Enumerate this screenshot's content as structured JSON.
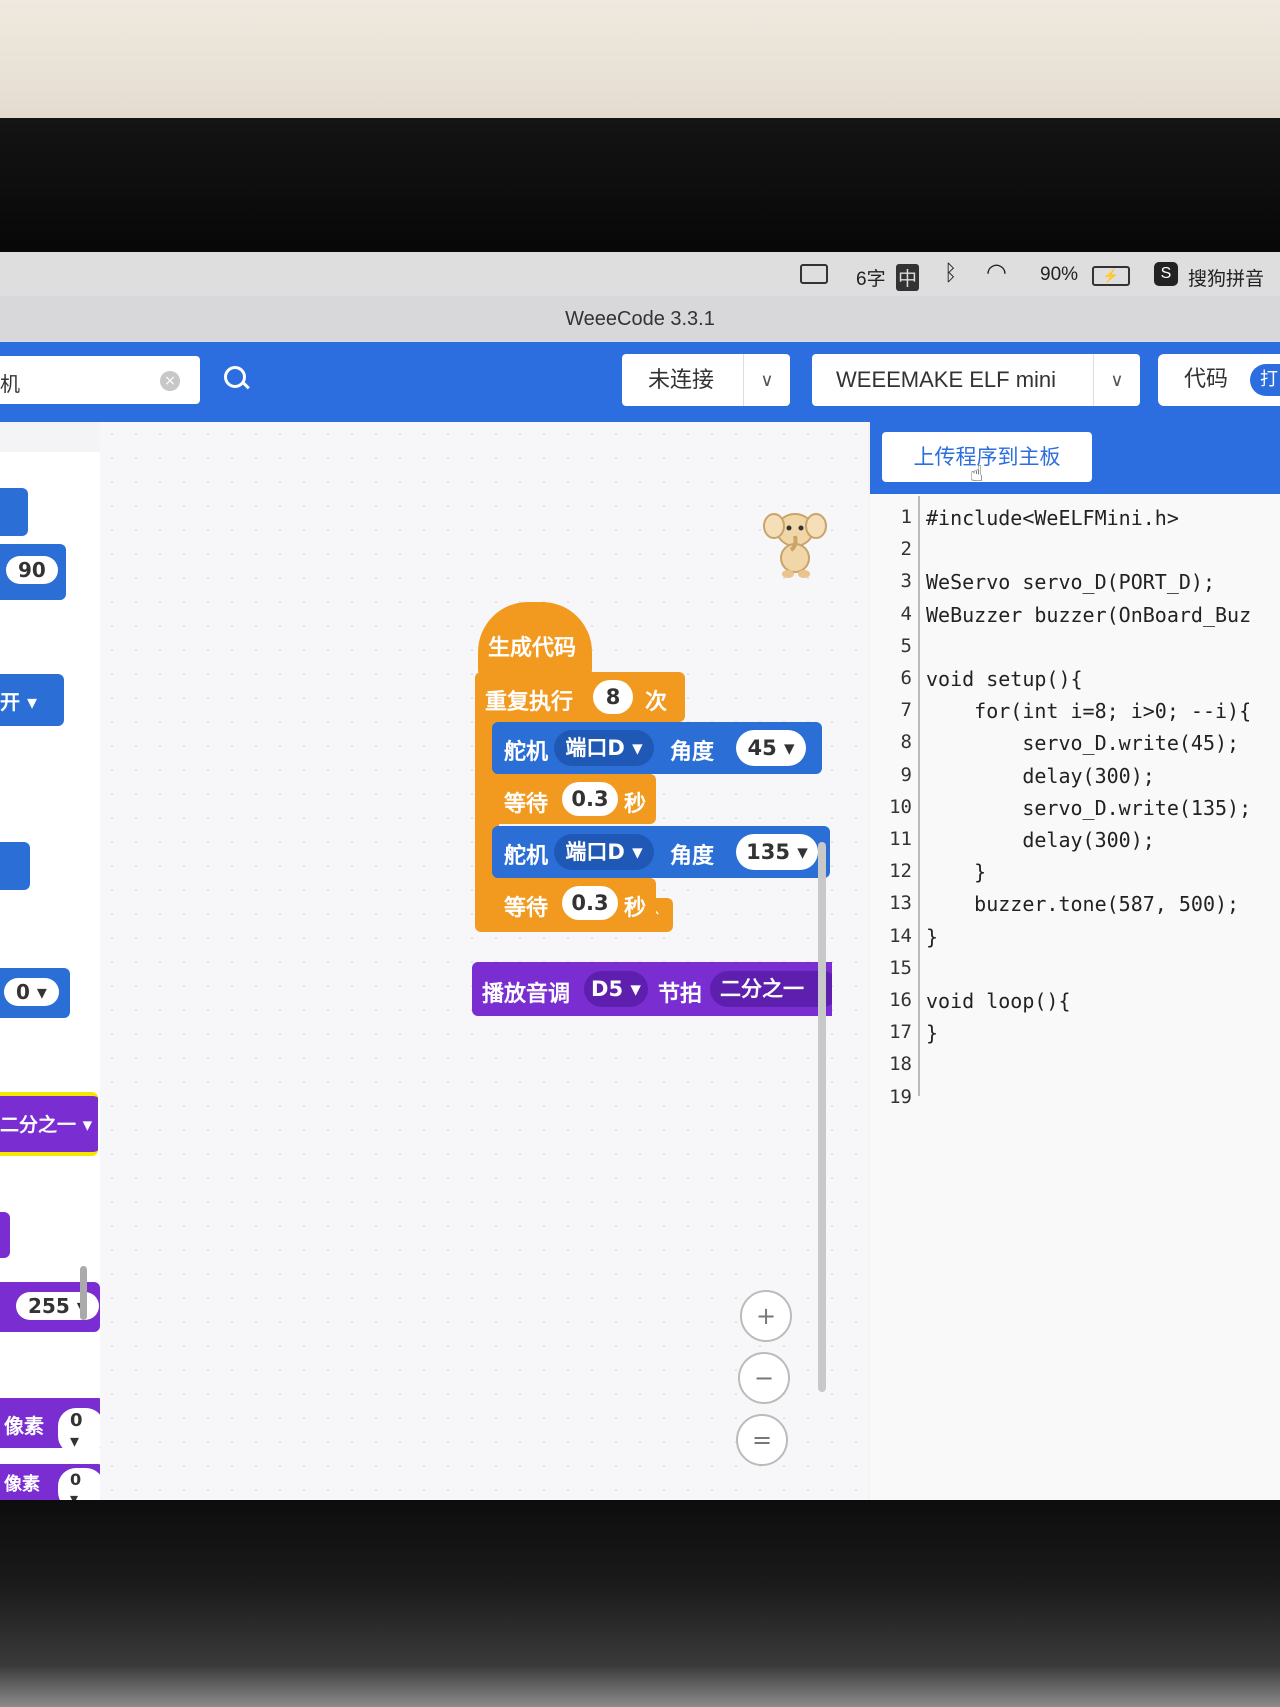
{
  "menubar": {
    "char_count": "6字",
    "input_mode": "中",
    "battery": "90%",
    "ime": "搜狗拼音"
  },
  "window": {
    "title": "WeeeCode 3.3.1"
  },
  "toolbar": {
    "search_value": "机",
    "connection": "未连接",
    "board": "WEEEMAKE ELF mini",
    "code_label": "代码",
    "code_toggle": "打"
  },
  "palette": {
    "items": [
      "90",
      "开 ▾",
      "0 ▾",
      "二分之一 ▾",
      "255 ▾",
      "像素",
      "0 ▾",
      "像素",
      "0 ▾"
    ]
  },
  "blocks": {
    "hat": "生成代码",
    "repeat": {
      "label": "重复执行",
      "count": "8",
      "unit": "次"
    },
    "servo1": {
      "label": "舵机",
      "port": "端口D ▾",
      "angle_label": "角度",
      "angle": "45 ▾"
    },
    "wait1": {
      "label": "等待",
      "value": "0.3",
      "unit": "秒"
    },
    "servo2": {
      "label": "舵机",
      "port": "端口D ▾",
      "angle_label": "角度",
      "angle": "135 ▾"
    },
    "wait2": {
      "label": "等待",
      "value": "0.3",
      "unit": "秒"
    },
    "tone": {
      "label": "播放音调",
      "note": "D5 ▾",
      "beat_label": "节拍",
      "beat": "二分之一"
    }
  },
  "zoom": {
    "in": "+",
    "out": "−",
    "reset": "="
  },
  "code": {
    "upload_label": "上传程序到主板",
    "line_numbers": [
      "1",
      "2",
      "3",
      "4",
      "5",
      "6",
      "7",
      "8",
      "9",
      "10",
      "11",
      "12",
      "13",
      "14",
      "15",
      "16",
      "17",
      "18",
      "19"
    ],
    "lines": [
      "#include<WeELFMini.h>",
      "",
      "WeServo servo_D(PORT_D);",
      "WeBuzzer buzzer(OnBoard_Buz",
      "",
      "void setup(){",
      "    for(int i=8; i>0; --i){",
      "        servo_D.write(45);",
      "        delay(300);",
      "        servo_D.write(135);",
      "        delay(300);",
      "    }",
      "    buzzer.tone(587, 500);",
      "}",
      "",
      "void loop(){",
      "}",
      "",
      ""
    ]
  }
}
